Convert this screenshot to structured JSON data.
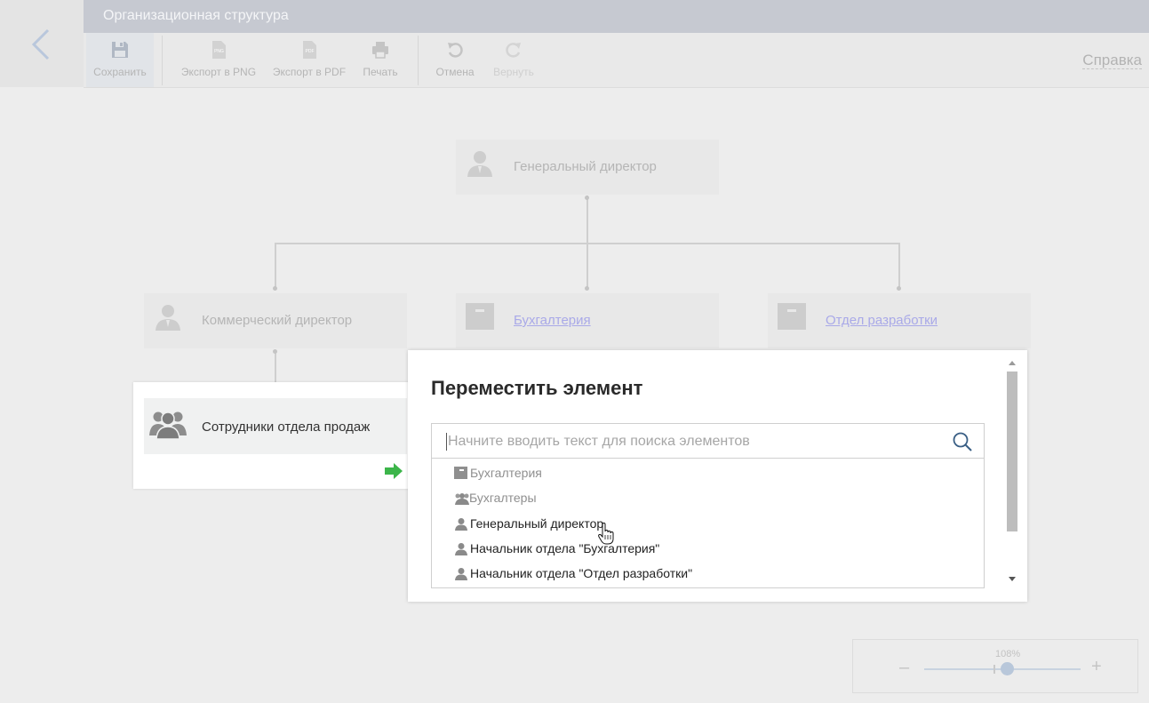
{
  "window": {
    "title": "Организационная структура"
  },
  "toolbar": {
    "save_label": "Сохранить",
    "export_png_label": "Экспорт в PNG",
    "export_pdf_label": "Экспорт в PDF",
    "print_label": "Печать",
    "undo_label": "Отмена",
    "redo_label": "Вернуть",
    "help_label": "Справка",
    "png_badge": "PNG",
    "pdf_badge": "PDF"
  },
  "org": {
    "root": "Генеральный директор",
    "commercial": "Коммерческий директор",
    "accounting": "Бухгалтерия",
    "development": "Отдел разработки",
    "sales_staff": "Сотрудники отдела продаж"
  },
  "move_dialog": {
    "title": "Переместить элемент",
    "search_placeholder": "Начните вводить текст для поиска элементов",
    "results": [
      {
        "label": "Бухгалтерия",
        "icon": "department-icon",
        "dimmed": true
      },
      {
        "label": "Бухгалтеры",
        "icon": "group-icon",
        "dimmed": true
      },
      {
        "label": "Генеральный директор",
        "icon": "person-icon",
        "dimmed": false
      },
      {
        "label": "Начальник отдела \"Бухгалтерия\"",
        "icon": "person-icon",
        "dimmed": false
      },
      {
        "label": "Начальник отдела \"Отдел разработки\"",
        "icon": "person-icon",
        "dimmed": false
      }
    ]
  },
  "zoom": {
    "value_label": "108%",
    "minus": "–",
    "plus": "+",
    "level_percent": 108
  },
  "colors": {
    "accent_arrow": "#3cb54a",
    "link": "#a9a9e8"
  }
}
